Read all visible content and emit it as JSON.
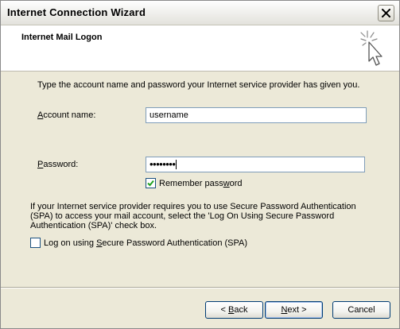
{
  "window": {
    "title": "Internet Connection Wizard"
  },
  "header": {
    "title": "Internet Mail Logon",
    "icon": "wizard-sparkle-cursor-icon"
  },
  "form": {
    "intro": "Type the account name and password your Internet service provider has given you.",
    "account_label_mnemonic": "A",
    "account_label_rest": "ccount name:",
    "account_value": "username",
    "password_label_mnemonic": "P",
    "password_label_rest": "assword:",
    "password_mask": "••••••••",
    "remember_label_pre": "Remember pass",
    "remember_label_mnemonic": "w",
    "remember_label_post": "ord",
    "remember_checked": true,
    "spa_info": "If your Internet service provider requires you to use Secure Password Authentication (SPA) to access your mail account, select the 'Log On Using Secure Password Authentication (SPA)' check box.",
    "spa_label_pre": "Log on using ",
    "spa_label_mnemonic": "S",
    "spa_label_post": "ecure Password Authentication (SPA)",
    "spa_checked": false
  },
  "buttons": {
    "back_mnemonic": "B",
    "back_rest": "ack",
    "back_prefix": "< ",
    "next_mnemonic": "N",
    "next_rest": "ext >",
    "cancel": "Cancel"
  },
  "colors": {
    "face": "#ece9d8",
    "field_border": "#7f9db9",
    "button_border": "#003c74",
    "check_mark": "#21a121"
  }
}
